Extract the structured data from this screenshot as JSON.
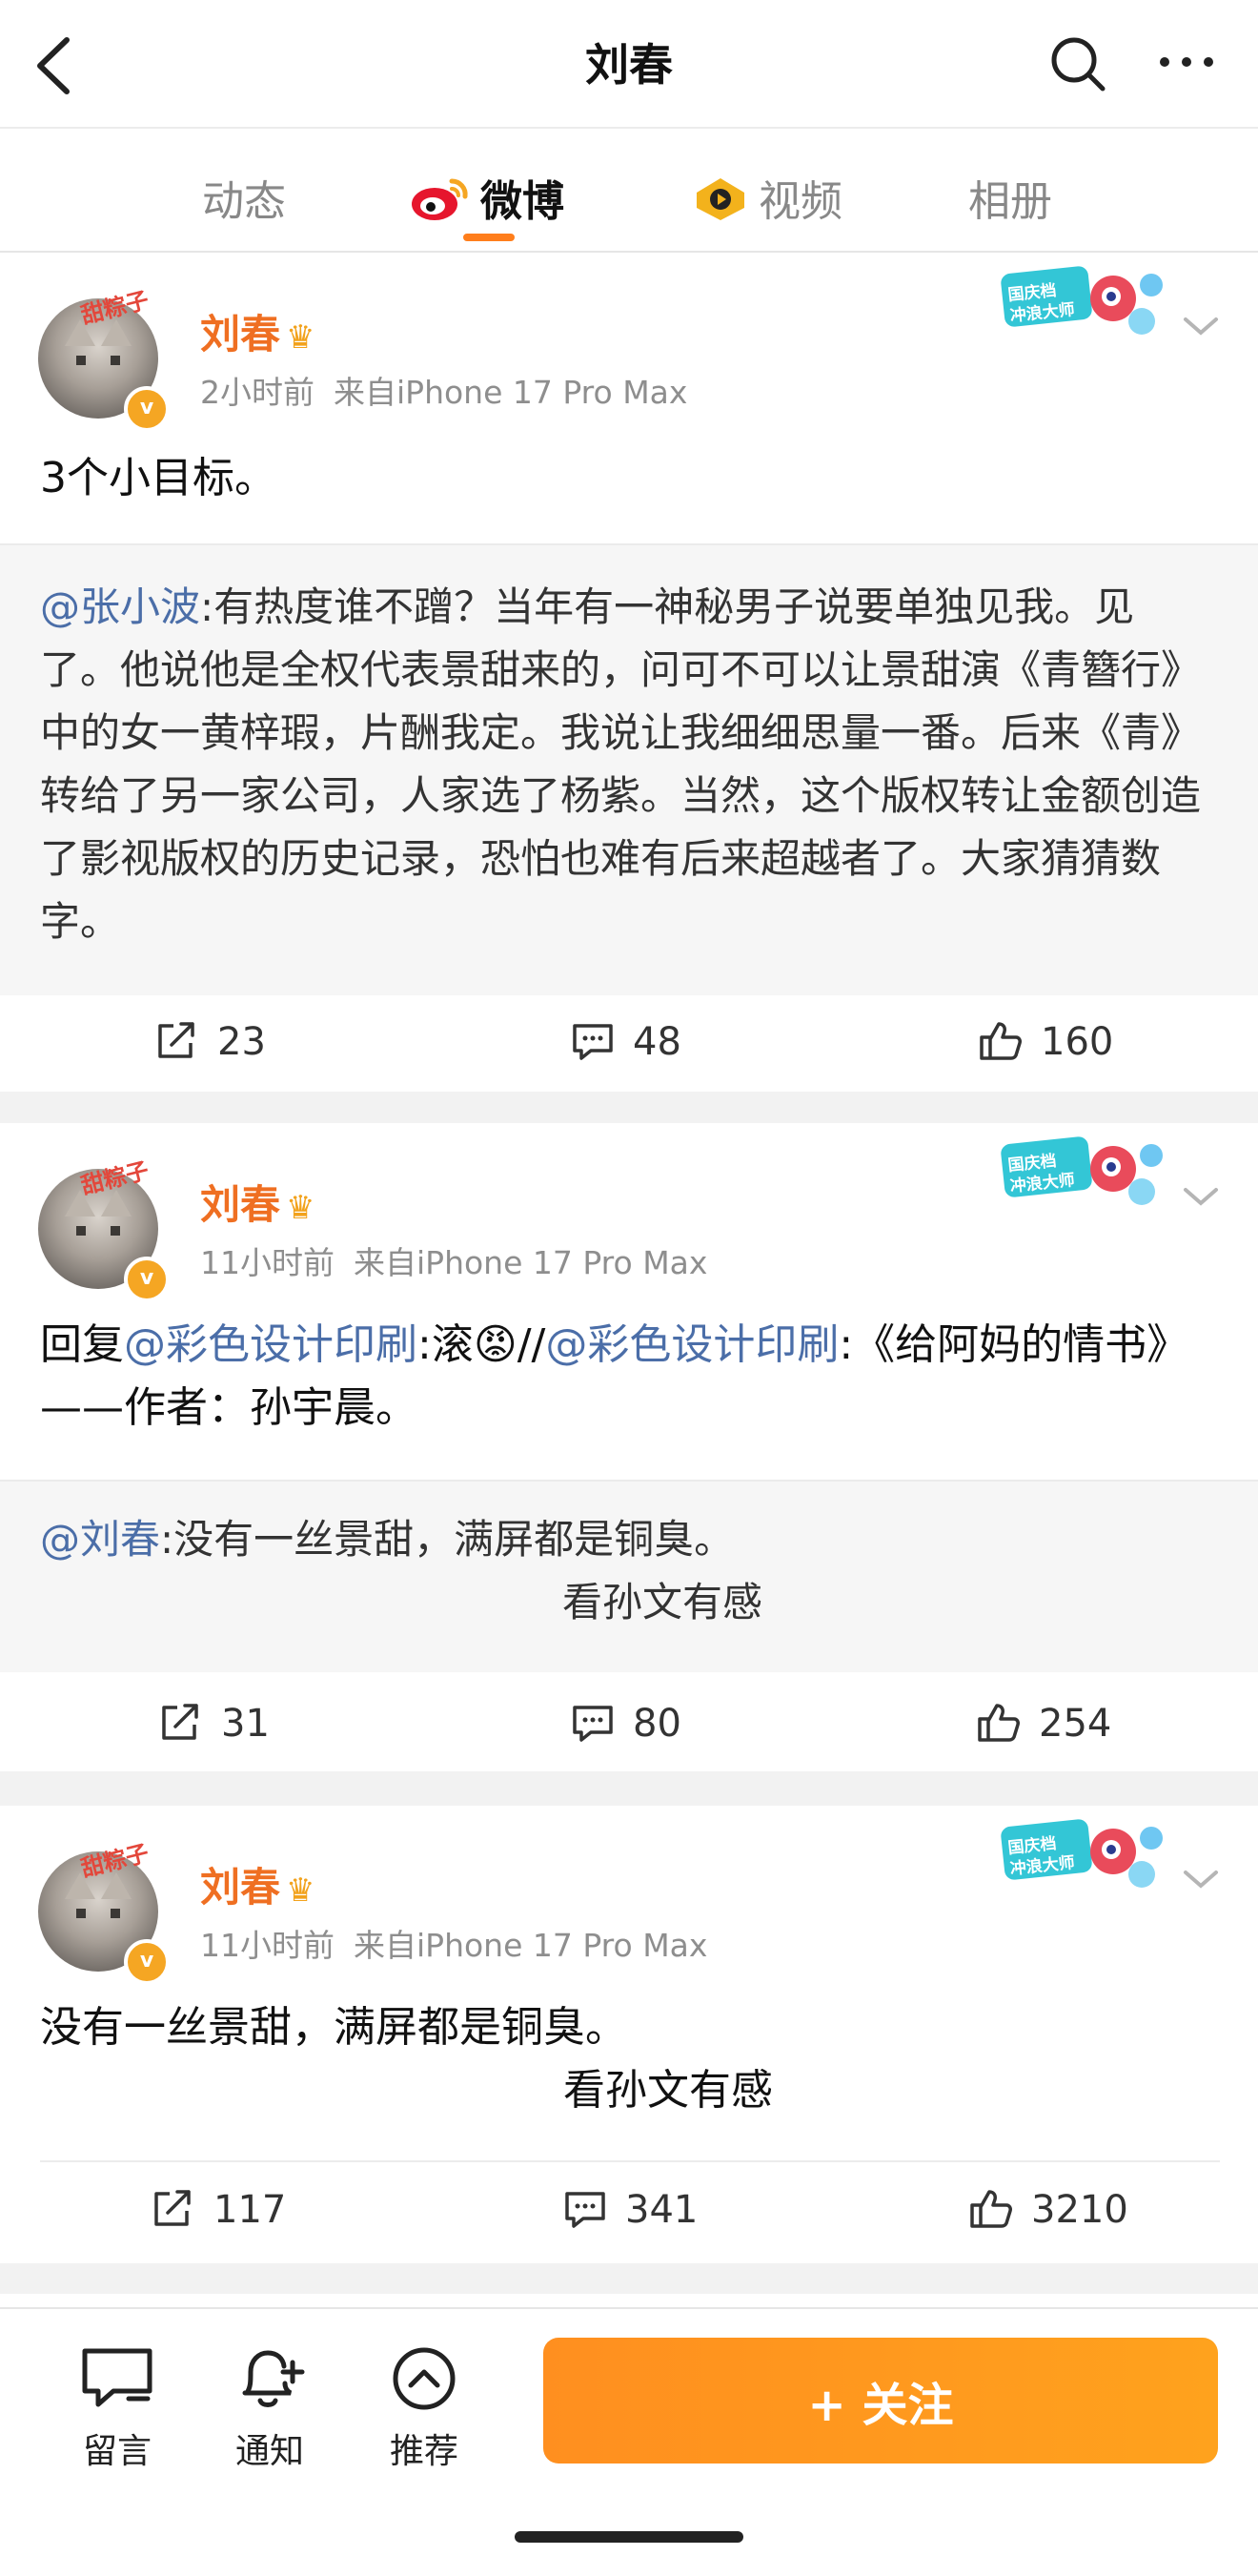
{
  "nav": {
    "title": "刘春",
    "tabs": [
      {
        "label": "动态",
        "active": false
      },
      {
        "label": "微博",
        "active": true
      },
      {
        "label": "视频",
        "active": false
      },
      {
        "label": "相册",
        "active": false
      }
    ]
  },
  "profile": {
    "name": "刘春",
    "avatar_tag": "甜粽子",
    "verified_mark": "v",
    "promo_badge_text": "国庆档 冲浪大师"
  },
  "posts": [
    {
      "time": "2小时前",
      "source": "来自iPhone 17 Pro Max",
      "text": "3个小目标。",
      "repost": {
        "mention": "@张小波",
        "text": ":有热度谁不蹭？当年有一神秘男子说要单独见我。见了。他说他是全权代表景甜来的，问可不可以让景甜演《青簪行》中的女一黄梓瑕，片酬我定。我说让我细细思量一番。后来《青》转给了另一家公司，人家选了杨紫。当然，这个版权转让金额创造了影视版权的历史记录，恐怕也难有后来超越者了。大家猜猜数字。"
      },
      "reposts": "23",
      "comments": "48",
      "likes": "160"
    },
    {
      "time": "11小时前",
      "source": "来自iPhone 17 Pro Max",
      "text_prefix": "回复",
      "mention1": "@彩色设计印刷",
      "text_mid": ":滚",
      "emoji": "😡",
      "separator": "//",
      "mention2": "@彩色设计印刷",
      "text_suffix": ":《给阿妈的情书》——作者：孙宇晨。",
      "repost": {
        "mention": "@刘春",
        "text": ":没有一丝景甜，满屏都是铜臭。",
        "line2": "看孙文有感"
      },
      "reposts": "31",
      "comments": "80",
      "likes": "254"
    },
    {
      "time": "11小时前",
      "source": "来自iPhone 17 Pro Max",
      "text": "没有一丝景甜，满屏都是铜臭。",
      "line2": "看孙文有感",
      "reposts": "117",
      "comments": "341",
      "likes": "3210"
    }
  ],
  "bottom": {
    "message_label": "留言",
    "notify_label": "通知",
    "recommend_label": "推荐",
    "follow_label": "+ 关注"
  },
  "colors": {
    "accent": "#ff7e1c",
    "name": "#ef6f22",
    "link": "#4b6ea8",
    "follow_button": "#ff951e"
  }
}
